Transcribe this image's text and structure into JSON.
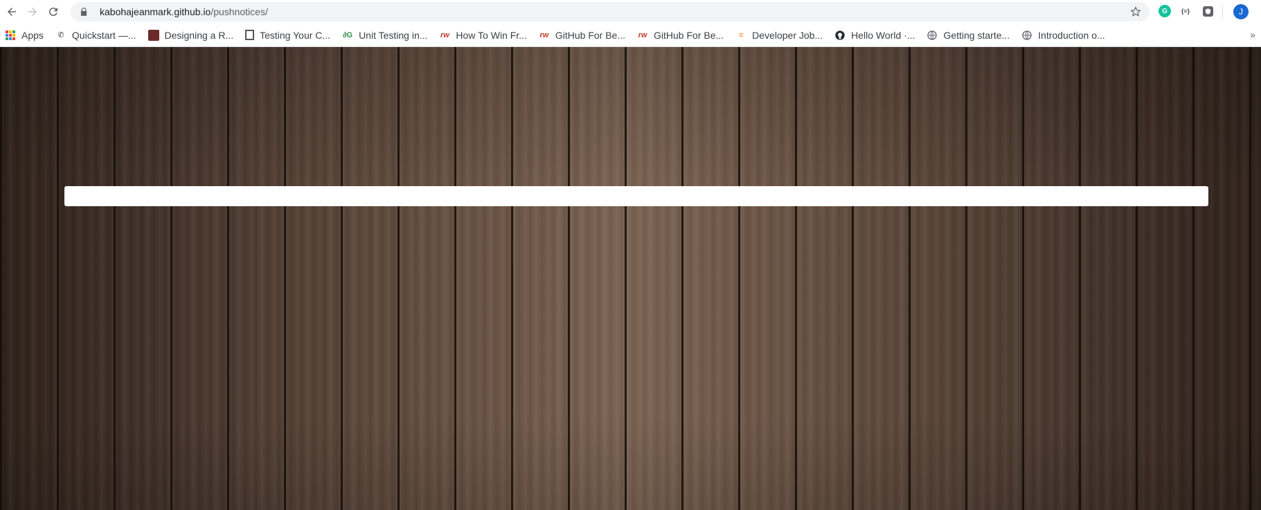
{
  "browser": {
    "url_host": "kabohajeanmark.github.io",
    "url_path": "/pushnotices/",
    "profile_initial": "J",
    "extensions": {
      "json_viewer_label": "{≡}"
    }
  },
  "bookmarks": [
    {
      "label": "Apps",
      "icon": "apps-grid-icon"
    },
    {
      "label": "Quickstart —...",
      "icon": "phone-icon"
    },
    {
      "label": "Designing a R...",
      "icon": "book-cover-icon"
    },
    {
      "label": "Testing Your C...",
      "icon": "building-icon"
    },
    {
      "label": "Unit Testing in...",
      "icon": "geeksforgeeks-icon"
    },
    {
      "label": "How To Win Fr...",
      "icon": "rw-icon"
    },
    {
      "label": "GitHub For Be...",
      "icon": "rw-icon"
    },
    {
      "label": "GitHub For Be...",
      "icon": "rw-icon"
    },
    {
      "label": "Developer Job...",
      "icon": "stackoverflow-icon"
    },
    {
      "label": "Hello World ·...",
      "icon": "github-icon"
    },
    {
      "label": "Getting starte...",
      "icon": "globe-icon"
    },
    {
      "label": "Introduction o...",
      "icon": "globe-icon"
    }
  ],
  "page": {
    "notice_input_value": "",
    "notice_input_placeholder": ""
  },
  "colors": {
    "wood_dark": "#2e211a",
    "wood_light": "#7d6453",
    "avatar": "#1967d2"
  }
}
